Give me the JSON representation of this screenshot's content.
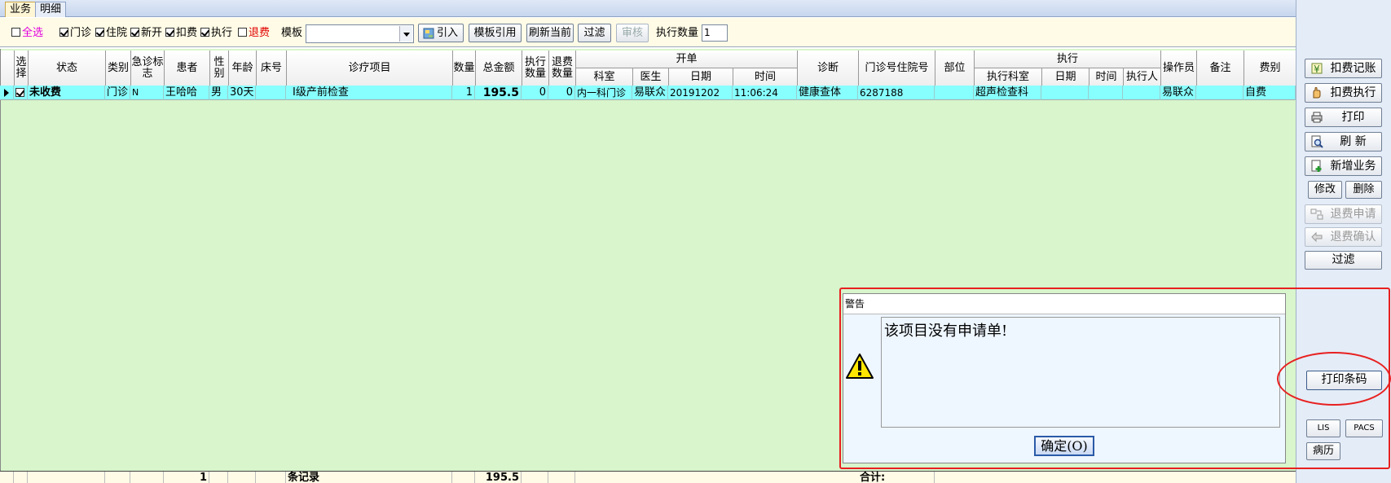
{
  "tabs": [
    {
      "label": "业务",
      "active": true
    },
    {
      "label": "明细",
      "active": false
    }
  ],
  "toolbar": {
    "select_all": {
      "label": "全选",
      "checked": false
    },
    "filters": [
      {
        "label": "门诊",
        "checked": true
      },
      {
        "label": "住院",
        "checked": true
      },
      {
        "label": "新开",
        "checked": true
      },
      {
        "label": "扣费",
        "checked": true
      },
      {
        "label": "执行",
        "checked": true
      },
      {
        "label": "退费",
        "checked": false
      }
    ],
    "template_label": "模板",
    "template_value": "",
    "import_button": "引入",
    "template_ref_button": "模板引用",
    "refresh_current_button": "刷新当前",
    "filter_button": "过滤",
    "audit_button": "审核",
    "exec_qty_label": "执行数量",
    "exec_qty_value": "1"
  },
  "grid": {
    "headers": {
      "select": "选择",
      "status": "状态",
      "category": "类别",
      "emergency": "急诊标志",
      "patient": "患者",
      "gender": "性别",
      "age": "年龄",
      "bed": "床号",
      "item": "诊疗项目",
      "qty": "数量",
      "amount": "总金额",
      "exec_qty": "执行数量",
      "refund_qty": "退费数量",
      "order_group": "开单",
      "order_dept": "科室",
      "order_doctor": "医生",
      "order_date": "日期",
      "order_time": "时间",
      "diagnosis": "诊断",
      "visit_no": "门诊号住院号",
      "body_part": "部位",
      "exec_group": "执行",
      "exec_dept": "执行科室",
      "exec_date": "日期",
      "exec_time": "时间",
      "exec_person": "执行人",
      "operator": "操作员",
      "remark": "备注",
      "fee_type": "费别"
    },
    "rows": [
      {
        "checked": true,
        "status": "未收费",
        "category": "门诊",
        "emergency": "N",
        "patient": "王哈哈",
        "gender": "男",
        "age": "30天",
        "bed": "",
        "item": "Ⅰ级产前检查",
        "qty": "1",
        "amount": "195.5",
        "exec_qty": "0",
        "refund_qty": "0",
        "order_dept": "内一科门诊",
        "order_doctor": "易联众",
        "order_date": "20191202",
        "order_time": "11:06:24",
        "diagnosis": "健康查体",
        "visit_no": "6287188",
        "body_part": "",
        "exec_dept": "超声检查科",
        "exec_date": "",
        "exec_time": "",
        "exec_person": "",
        "operator": "易联众",
        "remark": "",
        "fee_type": "自费"
      }
    ],
    "footer": {
      "patient_count": "1",
      "records_label": "条记录",
      "amount_total": "195.5",
      "total_label": "合计:"
    }
  },
  "side_panel": {
    "charge_record": "扣费记账",
    "charge_execute": "扣费执行",
    "print": "打印",
    "refresh": "刷  新",
    "new_business": "新增业务",
    "modify": "修改",
    "delete": "删除",
    "refund_apply": "退费申请",
    "refund_confirm": "退费确认",
    "filter": "过滤",
    "print_barcode": "打印条码",
    "lis": "LIS",
    "pacs": "PACS",
    "medical_record": "病历"
  },
  "dialog": {
    "title": "警告",
    "message": "该项目没有申请单!",
    "ok_button": "确定(O)",
    "ok_hotkey": "O"
  },
  "colors": {
    "grid_background": "#d8f5cc",
    "selected_row": "#88ffff",
    "annotation_red": "#e82020",
    "toolbar_background": "#fffbe6"
  }
}
